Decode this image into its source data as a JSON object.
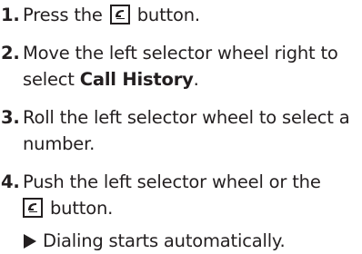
{
  "steps": [
    {
      "number": "1.",
      "text_before": "Press the ",
      "icon": "phone-icon",
      "text_after": " button."
    },
    {
      "number": "2.",
      "text_before": "Move the left selector wheel right to select ",
      "strong": "Call History",
      "text_after": "."
    },
    {
      "number": "3.",
      "text": "Roll the left selector wheel to select a number."
    },
    {
      "number": "4.",
      "text_before": "Push the left selector wheel or the ",
      "icon": "phone-icon",
      "text_after": " button."
    }
  ],
  "result": {
    "icon": "triangle-arrow-icon",
    "text": "Dialing starts automatically."
  },
  "colors": {
    "text": "#231f20",
    "background": "#ffffff"
  }
}
